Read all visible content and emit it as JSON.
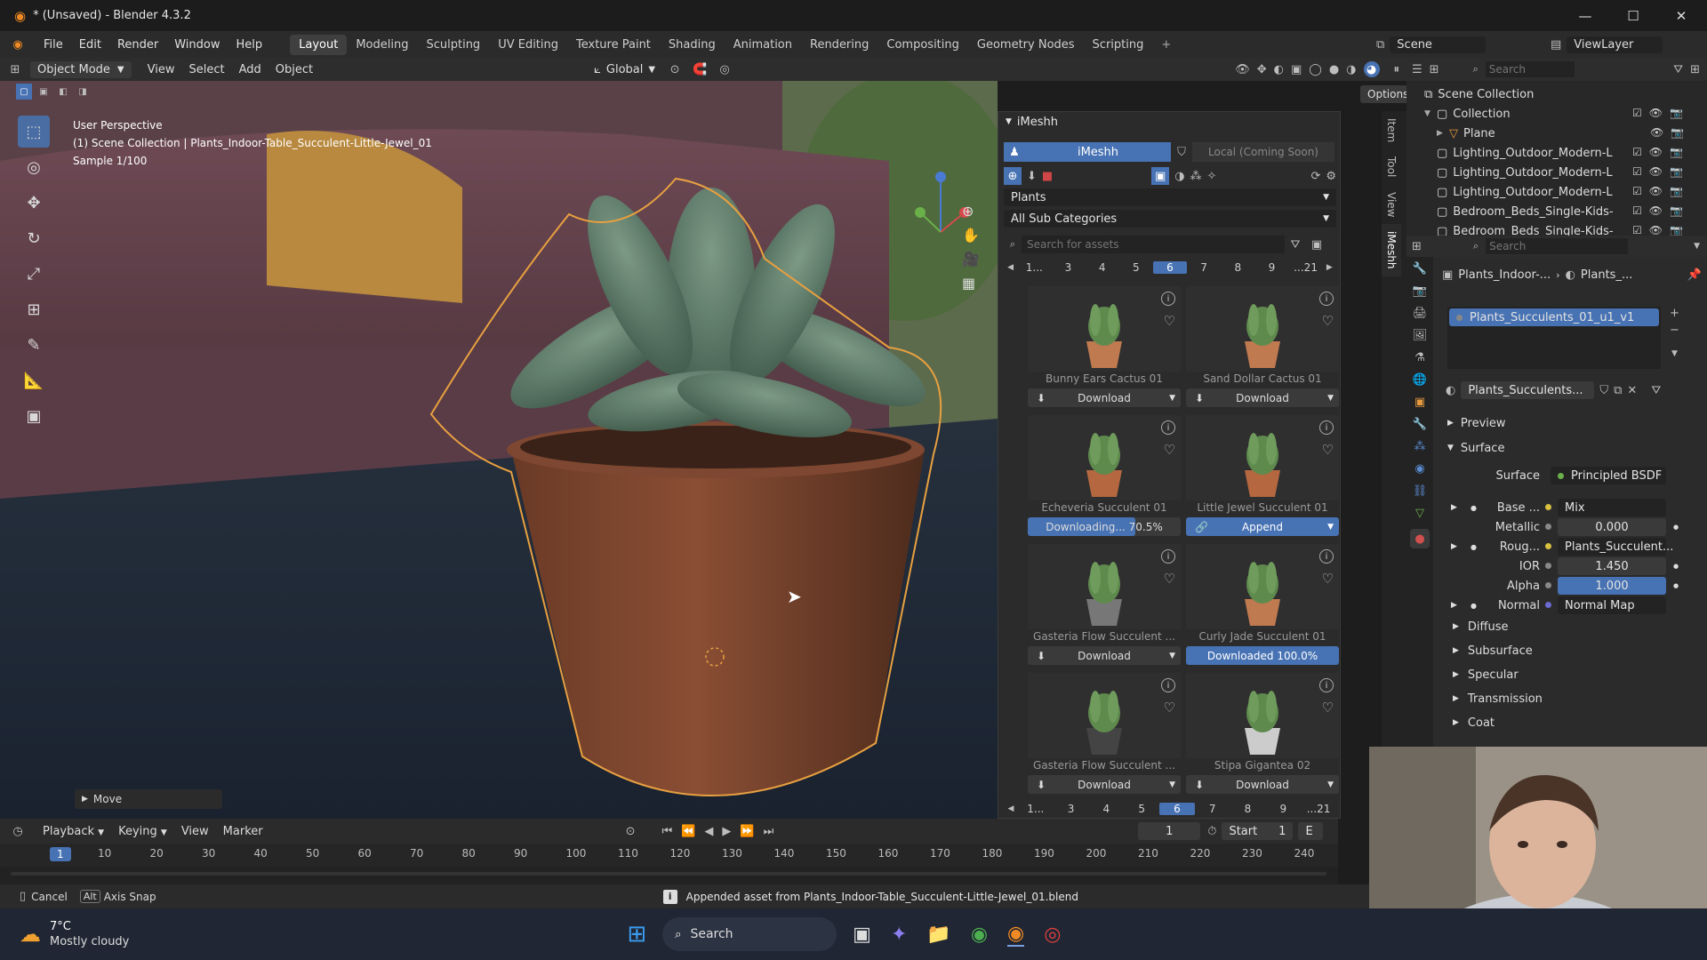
{
  "titlebar": {
    "title": "* (Unsaved) - Blender 4.3.2"
  },
  "menubar": {
    "menus": [
      "File",
      "Edit",
      "Render",
      "Window",
      "Help"
    ],
    "workspaces": [
      "Layout",
      "Modeling",
      "Sculpting",
      "UV Editing",
      "Texture Paint",
      "Shading",
      "Animation",
      "Rendering",
      "Compositing",
      "Geometry Nodes",
      "Scripting"
    ],
    "active_workspace": "Layout",
    "scene": "Scene",
    "viewlayer": "ViewLayer"
  },
  "viewport_header": {
    "mode": "Object Mode",
    "menus": [
      "View",
      "Select",
      "Add",
      "Object"
    ],
    "orientation": "Global",
    "options_label": "Options"
  },
  "viewport": {
    "perspective": "User Perspective",
    "collection_info": "(1) Scene Collection | Plants_Indoor-Table_Succulent-Little-Jewel_01",
    "sample": "Sample 1/100",
    "last_op": "Move"
  },
  "imeshh": {
    "panel_title": "iMeshh",
    "tab_main": "iMeshh",
    "tab_local": "Local (Coming Soon)",
    "category": "Plants",
    "subcategory": "All Sub Categories",
    "search_placeholder": "Search for assets",
    "pager": [
      "1...",
      "3",
      "4",
      "5",
      "6",
      "7",
      "8",
      "9",
      "...21"
    ],
    "pager_active": "6",
    "assets": [
      {
        "name": "Bunny Ears Cactus 01",
        "action": "Download",
        "state": "download"
      },
      {
        "name": "Sand Dollar Cactus 01",
        "action": "Download",
        "state": "download"
      },
      {
        "name": "Echeveria Succulent 01",
        "action": "Downloading... 70.5%",
        "state": "progress",
        "progress": 0.705
      },
      {
        "name": "Little Jewel Succulent 01",
        "action": "Append",
        "state": "append"
      },
      {
        "name": "Gasteria Flow Succulent ...",
        "action": "Download",
        "state": "download"
      },
      {
        "name": "Curly Jade Succulent 01",
        "action": "Downloaded 100.0%",
        "state": "done",
        "progress": 1.0
      },
      {
        "name": "Gasteria Flow Succulent ...",
        "action": "Download",
        "state": "download"
      },
      {
        "name": "Stipa Gigantea 02",
        "action": "Download",
        "state": "download"
      }
    ]
  },
  "sidetabs": [
    "Item",
    "Tool",
    "View",
    "iMeshh"
  ],
  "outliner": {
    "search_placeholder": "Search",
    "rows": [
      {
        "label": "Scene Collection",
        "indent": 0
      },
      {
        "label": "Collection",
        "indent": 1
      },
      {
        "label": "Plane",
        "indent": 2
      },
      {
        "label": "Lighting_Outdoor_Modern-Lan",
        "indent": 1
      },
      {
        "label": "Lighting_Outdoor_Modern-Lan",
        "indent": 1
      },
      {
        "label": "Lighting_Outdoor_Modern-Lan",
        "indent": 1
      },
      {
        "label": "Bedroom_Beds_Single-Kids-H",
        "indent": 1
      },
      {
        "label": "Bedroom_Beds_Single-Kids-H",
        "indent": 1
      }
    ]
  },
  "properties": {
    "search_placeholder": "Search",
    "breadcrumb_object": "Plants_Indoor-...",
    "breadcrumb_material": "Plants_...",
    "material_slot": "Plants_Succulents_01_u1_v1",
    "material_name": "Plants_Succulents...",
    "sections": {
      "preview": "Preview",
      "surface": "Surface"
    },
    "surface_label": "Surface",
    "surface_value": "Principled BSDF",
    "inputs": [
      {
        "label": "Base ...",
        "value": "Mix",
        "type": "link"
      },
      {
        "label": "Metallic",
        "value": "0.000",
        "type": "number"
      },
      {
        "label": "Roug...",
        "value": "Plants_Succulent...",
        "type": "link"
      },
      {
        "label": "IOR",
        "value": "1.450",
        "type": "number"
      },
      {
        "label": "Alpha",
        "value": "1.000",
        "type": "blue"
      },
      {
        "label": "Normal",
        "value": "Normal Map",
        "type": "link"
      }
    ],
    "subsections": [
      "Diffuse",
      "Subsurface",
      "Specular",
      "Transmission",
      "Coat"
    ]
  },
  "timeline": {
    "menus": [
      "Playback",
      "Keying",
      "View",
      "Marker"
    ],
    "current_frame": "1",
    "start_label": "Start",
    "start_value": "1",
    "end_label": "E",
    "ruler": [
      "1",
      "10",
      "20",
      "30",
      "40",
      "50",
      "60",
      "70",
      "80",
      "90",
      "100",
      "110",
      "120",
      "130",
      "140",
      "150",
      "160",
      "170",
      "180",
      "190",
      "200",
      "210",
      "220",
      "230",
      "240"
    ]
  },
  "statusbar": {
    "cancel": "Cancel",
    "alt_key": "Alt",
    "axis_snap": "Axis Snap",
    "message": "Appended asset from Plants_Indoor-Table_Succulent-Little-Jewel_01.blend"
  },
  "taskbar": {
    "temperature": "7°C",
    "weather": "Mostly cloudy",
    "search": "Search"
  },
  "colors": {
    "accent": "#4772b3",
    "selection_outline": "#e8a040",
    "panel": "#2b2b2b"
  }
}
